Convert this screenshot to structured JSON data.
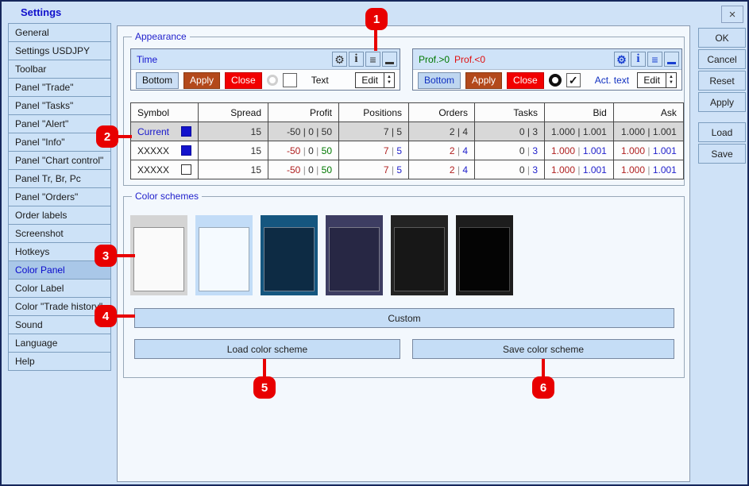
{
  "window": {
    "title": "Settings",
    "close_glyph": "×"
  },
  "sidebar": {
    "items": [
      {
        "label": "General",
        "selected": false
      },
      {
        "label": "Settings USDJPY",
        "selected": false
      },
      {
        "label": "Toolbar",
        "selected": false
      },
      {
        "label": "Panel \"Trade\"",
        "selected": false
      },
      {
        "label": "Panel \"Tasks\"",
        "selected": false
      },
      {
        "label": "Panel \"Alert\"",
        "selected": false
      },
      {
        "label": "Panel \"Info\"",
        "selected": false
      },
      {
        "label": "Panel \"Chart control\"",
        "selected": false
      },
      {
        "label": "Panel Tr, Br, Pc",
        "selected": false
      },
      {
        "label": "Panel \"Orders\"",
        "selected": false
      },
      {
        "label": "Order labels",
        "selected": false
      },
      {
        "label": "Screenshot",
        "selected": false
      },
      {
        "label": "Hotkeys",
        "selected": false
      },
      {
        "label": "Color Panel",
        "selected": true
      },
      {
        "label": "Color Label",
        "selected": false
      },
      {
        "label": "Color \"Trade history\"",
        "selected": false
      },
      {
        "label": "Sound",
        "selected": false
      },
      {
        "label": "Language",
        "selected": false
      },
      {
        "label": "Help",
        "selected": false
      }
    ]
  },
  "appearance": {
    "legend": "Appearance",
    "panel_icons": [
      {
        "name": "gear-icon",
        "glyph": "⚙"
      },
      {
        "name": "info-icon",
        "glyph": "i"
      },
      {
        "name": "menu-icon",
        "glyph": "≡"
      },
      {
        "name": "minimize-icon",
        "glyph": ""
      }
    ],
    "time_panel": {
      "title": "Time",
      "bottom_label": "Bottom",
      "apply_label": "Apply",
      "close_label": "Close",
      "text_label": "Text",
      "edit_label": "Edit",
      "radio_state": "off",
      "checkbox_state": "unchecked"
    },
    "profit_panel": {
      "title_pos": "Prof.>0",
      "title_neg": "Prof.<0",
      "bottom_label": "Bottom",
      "apply_label": "Apply",
      "close_label": "Close",
      "text_label": "Act. text",
      "edit_label": "Edit",
      "radio_state": "on",
      "checkbox_state": "checked",
      "check_glyph": "✓"
    }
  },
  "table": {
    "headers": [
      "Symbol",
      "Spread",
      "Profit",
      "Positions",
      "Orders",
      "Tasks",
      "Bid",
      "Ask"
    ],
    "rows": [
      {
        "symbol": {
          "text": "Current",
          "color": "#1515cc"
        },
        "checkbox": "filled",
        "row_bg": "gray",
        "cells": [
          [
            [
              "15",
              "#303030"
            ]
          ],
          [
            [
              "-50 | 0 | 50",
              "#303030"
            ]
          ],
          [
            [
              "7 | 5",
              "#303030"
            ]
          ],
          [
            [
              "2 | 4",
              "#303030"
            ]
          ],
          [
            [
              "0 | 3",
              "#303030"
            ]
          ],
          [
            [
              "1.000 | 1.001",
              "#303030"
            ]
          ],
          [
            [
              "1.000 | 1.001",
              "#303030"
            ]
          ]
        ]
      },
      {
        "symbol": {
          "text": "XXXXX",
          "color": "#202020"
        },
        "checkbox": "filled",
        "row_bg": "white",
        "cells": [
          [
            [
              "15",
              "#303030"
            ]
          ],
          [
            [
              "-50",
              "#b02020"
            ],
            [
              " | ",
              "#909090"
            ],
            [
              "0",
              "#303030"
            ],
            [
              " | ",
              "#909090"
            ],
            [
              "50",
              "#007800"
            ]
          ],
          [
            [
              "7",
              "#b02020"
            ],
            [
              " | ",
              "#909090"
            ],
            [
              "5",
              "#2222cc"
            ]
          ],
          [
            [
              "2",
              "#b02020"
            ],
            [
              " | ",
              "#909090"
            ],
            [
              "4",
              "#2222cc"
            ]
          ],
          [
            [
              "0",
              "#303030"
            ],
            [
              " | ",
              "#909090"
            ],
            [
              "3",
              "#2222cc"
            ]
          ],
          [
            [
              "1.000",
              "#b02020"
            ],
            [
              " | ",
              "#909090"
            ],
            [
              "1.001",
              "#2222cc"
            ]
          ],
          [
            [
              "1.000",
              "#b02020"
            ],
            [
              " | ",
              "#909090"
            ],
            [
              "1.001",
              "#2222cc"
            ]
          ]
        ]
      },
      {
        "symbol": {
          "text": "XXXXX",
          "color": "#202020"
        },
        "checkbox": "empty",
        "row_bg": "white",
        "cells": [
          [
            [
              "15",
              "#303030"
            ]
          ],
          [
            [
              "-50",
              "#b02020"
            ],
            [
              " | ",
              "#909090"
            ],
            [
              "0",
              "#303030"
            ],
            [
              " | ",
              "#909090"
            ],
            [
              "50",
              "#007800"
            ]
          ],
          [
            [
              "7",
              "#b02020"
            ],
            [
              " | ",
              "#909090"
            ],
            [
              "5",
              "#2222cc"
            ]
          ],
          [
            [
              "2",
              "#b02020"
            ],
            [
              " | ",
              "#909090"
            ],
            [
              "4",
              "#2222cc"
            ]
          ],
          [
            [
              "0",
              "#303030"
            ],
            [
              " | ",
              "#909090"
            ],
            [
              "3",
              "#2222cc"
            ]
          ],
          [
            [
              "1.000",
              "#b02020"
            ],
            [
              " | ",
              "#909090"
            ],
            [
              "1.001",
              "#2222cc"
            ]
          ],
          [
            [
              "1.000",
              "#b02020"
            ],
            [
              " | ",
              "#909090"
            ],
            [
              "1.001",
              "#2222cc"
            ]
          ]
        ]
      }
    ]
  },
  "color_schemes": {
    "legend": "Color schemes",
    "swatches": [
      {
        "name": "scheme-light-gray",
        "outer": "#d4d4d4",
        "inner": "#fafafa",
        "border": "#909090"
      },
      {
        "name": "scheme-light-blue",
        "outer": "#c2dcf7",
        "inner": "#f5faff",
        "border": "#98a8b8"
      },
      {
        "name": "scheme-dark-blue",
        "outer": "#15567f",
        "inner": "#0d2b44",
        "border": "#708090"
      },
      {
        "name": "scheme-dark-purple",
        "outer": "#3d3d62",
        "inner": "#272744",
        "border": "#7a7a8a"
      },
      {
        "name": "scheme-dark-gray",
        "outer": "#232323",
        "inner": "#171717",
        "border": "#5a5a5a"
      },
      {
        "name": "scheme-black",
        "outer": "#1d1d1d",
        "inner": "#040404",
        "border": "#4a4a4a"
      }
    ],
    "custom_label": "Custom",
    "load_label": "Load color scheme",
    "save_label": "Save color scheme"
  },
  "action_buttons": [
    "OK",
    "Cancel",
    "Reset",
    "Apply"
  ],
  "file_buttons": [
    "Load",
    "Save"
  ],
  "badges": [
    "1",
    "2",
    "3",
    "4",
    "5",
    "6"
  ],
  "colors": {
    "window_bg": "#cfe2f7",
    "window_border": "#16275b",
    "main_bg": "#f3f8fd",
    "accent_blue": "#1515d0",
    "profit_green": "#007800",
    "loss_red": "#e01010",
    "apply_orange": "#b3491b",
    "close_red": "#f20000",
    "badge_red": "#e80000",
    "selected_item_bg": "#a9c7e8",
    "current_row_bg": "#d8d8d8"
  }
}
